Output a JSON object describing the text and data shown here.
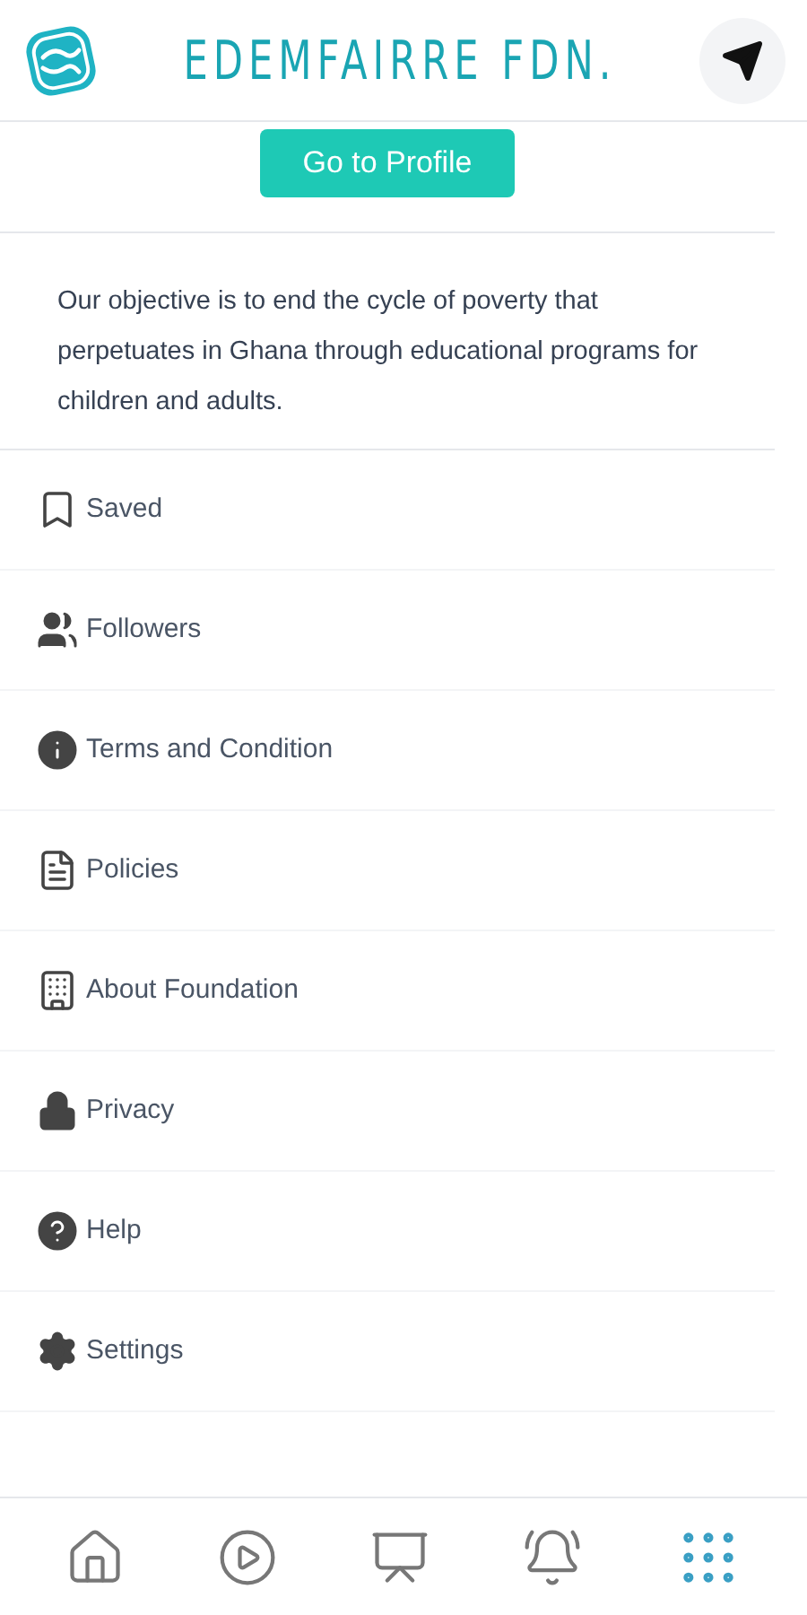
{
  "header": {
    "title": "EDEMFAIRRE FDN."
  },
  "profile_button": "Go to Profile",
  "description": "Our objective is to end the cycle of poverty that perpetuates in Ghana through educational programs for children and adults.",
  "menu": [
    {
      "kind": "saved",
      "label": "Saved"
    },
    {
      "kind": "followers",
      "label": "Followers"
    },
    {
      "kind": "info",
      "label": "Terms and Condition"
    },
    {
      "kind": "document",
      "label": "Policies"
    },
    {
      "kind": "building",
      "label": "About Foundation"
    },
    {
      "kind": "lock",
      "label": "Privacy"
    },
    {
      "kind": "help",
      "label": "Help"
    },
    {
      "kind": "settings",
      "label": "Settings"
    }
  ],
  "bottom_nav": [
    {
      "kind": "home",
      "selected": false
    },
    {
      "kind": "broadcast",
      "selected": false
    },
    {
      "kind": "meeting",
      "selected": false
    },
    {
      "kind": "bell",
      "selected": false
    },
    {
      "kind": "grid",
      "selected": true
    }
  ]
}
